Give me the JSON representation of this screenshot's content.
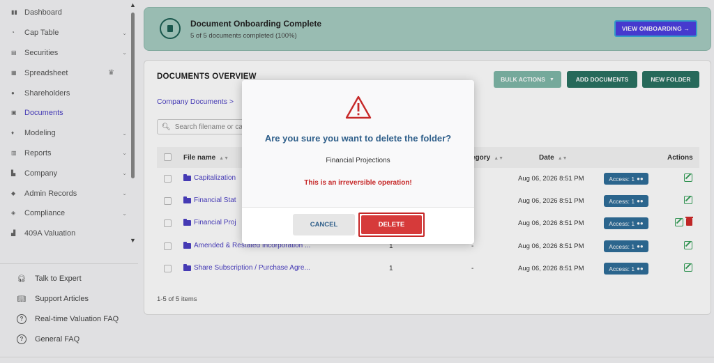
{
  "sidebar": {
    "items": [
      {
        "label": "Dashboard",
        "icon": "dashboard-icon",
        "has_chevron": false
      },
      {
        "label": "Cap Table",
        "icon": "pie-chart-icon",
        "has_chevron": true
      },
      {
        "label": "Securities",
        "icon": "clipboard-icon",
        "has_chevron": true
      },
      {
        "label": "Spreadsheet",
        "icon": "spreadsheet-icon",
        "has_chevron": false,
        "badge_icon": "crown-icon"
      },
      {
        "label": "Shareholders",
        "icon": "person-icon",
        "has_chevron": false
      },
      {
        "label": "Documents",
        "icon": "documents-icon",
        "has_chevron": false,
        "active": true
      },
      {
        "label": "Modeling",
        "icon": "lightbulb-icon",
        "has_chevron": true
      },
      {
        "label": "Reports",
        "icon": "reports-icon",
        "has_chevron": true
      },
      {
        "label": "Company",
        "icon": "building-icon",
        "has_chevron": true
      },
      {
        "label": "Admin Records",
        "icon": "admin-icon",
        "has_chevron": true
      },
      {
        "label": "Compliance",
        "icon": "shield-icon",
        "has_chevron": true
      },
      {
        "label": "409A Valuation",
        "icon": "chart-icon",
        "has_chevron": false
      }
    ],
    "help": [
      {
        "label": "Talk to Expert",
        "icon": "headset-icon"
      },
      {
        "label": "Support Articles",
        "icon": "book-icon"
      },
      {
        "label": "Real-time Valuation FAQ",
        "icon": "question-icon"
      },
      {
        "label": "General FAQ",
        "icon": "question-icon"
      }
    ]
  },
  "banner": {
    "title": "Document Onboarding Complete",
    "subtitle": "5 of 5 documents completed (100%)",
    "button": "VIEW ONBOARDING →"
  },
  "documents": {
    "title": "DOCUMENTS OVERVIEW",
    "bulk_actions": "BULK ACTIONS",
    "add_documents": "ADD DOCUMENTS",
    "new_folder": "NEW FOLDER",
    "breadcrumb": "Company Documents  >",
    "search_placeholder": "Search filename or ca",
    "columns": {
      "file_name": "File name",
      "category": "egory",
      "date": "Date",
      "actions": "Actions"
    },
    "rows": [
      {
        "name": "Capitalization",
        "version": "",
        "category": "",
        "date": "Aug 06, 2026 8:51 PM",
        "access": "Access: 1",
        "deletable": false
      },
      {
        "name": "Financial Stat",
        "version": "",
        "category": "",
        "date": "Aug 06, 2026 8:51 PM",
        "access": "Access: 1",
        "deletable": false
      },
      {
        "name": "Financial Proj",
        "version": "",
        "category": "",
        "date": "Aug 06, 2026 8:51 PM",
        "access": "Access: 1",
        "deletable": true
      },
      {
        "name": "Amended & Restated Incorporation ...",
        "version": "1",
        "category": "-",
        "date": "Aug 06, 2026 8:51 PM",
        "access": "Access: 1",
        "deletable": false
      },
      {
        "name": "Share Subscription / Purchase Agre...",
        "version": "1",
        "category": "-",
        "date": "Aug 06, 2026 8:51 PM",
        "access": "Access: 1",
        "deletable": false
      }
    ],
    "count": "1-5 of 5 items"
  },
  "modal": {
    "question": "Are you sure you want to delete the folder?",
    "folder_name": "Financial Projections",
    "warning": "This is an irreversible operation!",
    "cancel": "CANCEL",
    "delete": "DELETE"
  },
  "colors": {
    "accent": "#4b3fc4",
    "primary_green": "#2a7262",
    "danger": "#d63a3a",
    "banner_bg": "#a7cdc2"
  }
}
